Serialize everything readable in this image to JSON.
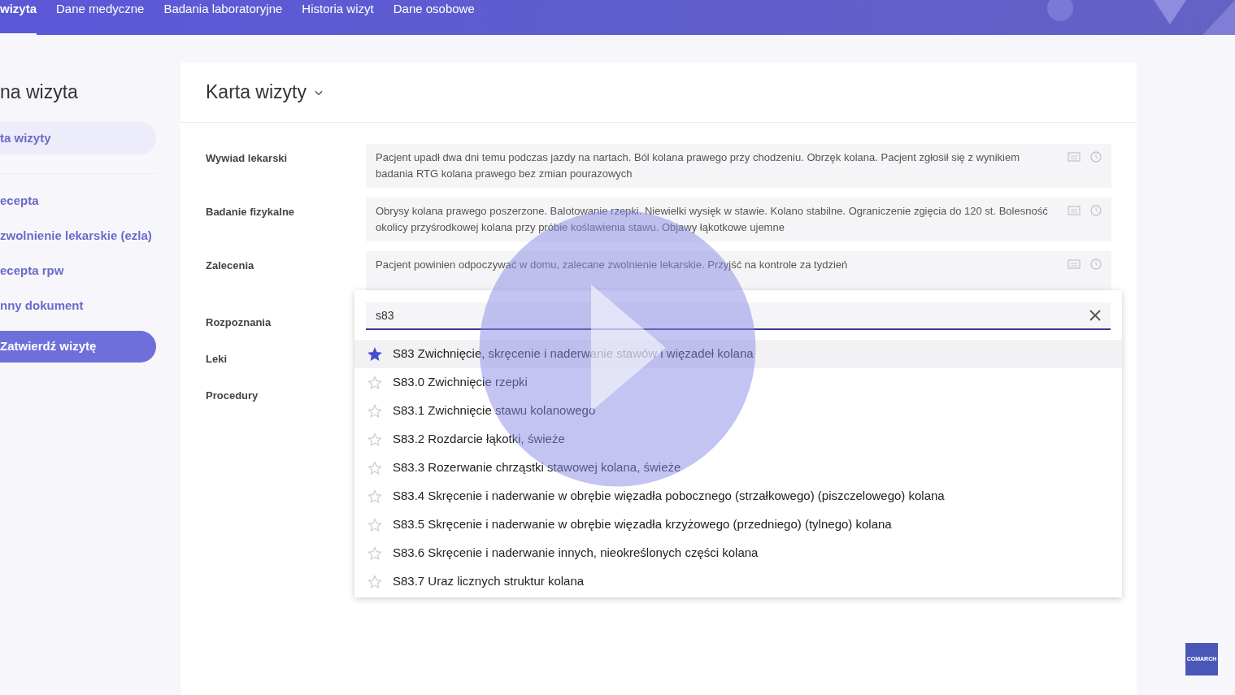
{
  "top_nav": [
    {
      "label": "wizyta",
      "selected": true
    },
    {
      "label": "Dane medyczne",
      "selected": false
    },
    {
      "label": "Badania laboratoryjne",
      "selected": false
    },
    {
      "label": "Historia wizyt",
      "selected": false
    },
    {
      "label": "Dane osobowe",
      "selected": false
    }
  ],
  "sidebar": {
    "title": "na wizyta",
    "items": [
      {
        "label": "ta wizyty",
        "selected": true
      }
    ],
    "documents": [
      {
        "label": "ecepta"
      },
      {
        "label": "zwolnienie lekarskie (ezla)"
      },
      {
        "label": "ecepta rpw"
      },
      {
        "label": "nny dokument"
      }
    ],
    "confirm_button": "Zatwierdź wizytę"
  },
  "card": {
    "title": "Karta wizyty",
    "fields": [
      {
        "label": "Wywiad lekarski",
        "value": "Pacjent upadł dwa dni temu podczas jazdy na nartach. Ból kolana prawego przy chodzeniu. Obrzęk kolana. Pacjent zgłosił się z wynikiem badania RTG kolana prawego bez zmian pourazowych"
      },
      {
        "label": "Badanie fizykalne",
        "value": "Obrysy kolana prawego poszerzone. Balotowanie rzepki. Niewielki wysięk w stawie. Kolano stabilne. Ograniczenie zgięcia do 120 st. Bolesność okolicy przyśrodkowej kolana przy próbie koślawienia stawu. Objawy łąkotkowe ujemne"
      },
      {
        "label": "Zalecenia",
        "value": "Pacjent powinien odpoczywać w domu, zalecane zwolnienie lekarskie. Przyjść na kontrole za tydzień"
      }
    ],
    "sections": [
      {
        "label": "Rozpoznania"
      },
      {
        "label": "Leki"
      },
      {
        "label": "Procedury"
      }
    ]
  },
  "diagnosis_dropdown": {
    "search_value": "s83",
    "options": [
      {
        "label": "S83 Zwichnięcie, skręcenie i naderwanie stawów i więzadeł kolana",
        "favorite": true,
        "selected": true
      },
      {
        "label": "S83.0 Zwichnięcie rzepki",
        "favorite": false,
        "selected": false
      },
      {
        "label": "S83.1 Zwichnięcie stawu kolanowego",
        "favorite": false,
        "selected": false
      },
      {
        "label": "S83.2 Rozdarcie łąkotki, świeże",
        "favorite": false,
        "selected": false
      },
      {
        "label": "S83.3 Rozerwanie chrząstki stawowej kolana, świeże",
        "favorite": false,
        "selected": false
      },
      {
        "label": "S83.4 Skręcenie i naderwanie w obrębie więzadła pobocznego (strzałkowego) (piszczelowego) kolana",
        "favorite": false,
        "selected": false
      },
      {
        "label": "S83.5 Skręcenie i naderwanie w obrębie więzadła krzyżowego (przedniego) (tylnego) kolana",
        "favorite": false,
        "selected": false
      },
      {
        "label": "S83.6 Skręcenie i naderwanie innych, nieokreślonych części kolana",
        "favorite": false,
        "selected": false
      },
      {
        "label": "S83.7 Uraz licznych struktur kolana",
        "favorite": false,
        "selected": false
      }
    ]
  },
  "logo": {
    "text": "COMARCH"
  }
}
